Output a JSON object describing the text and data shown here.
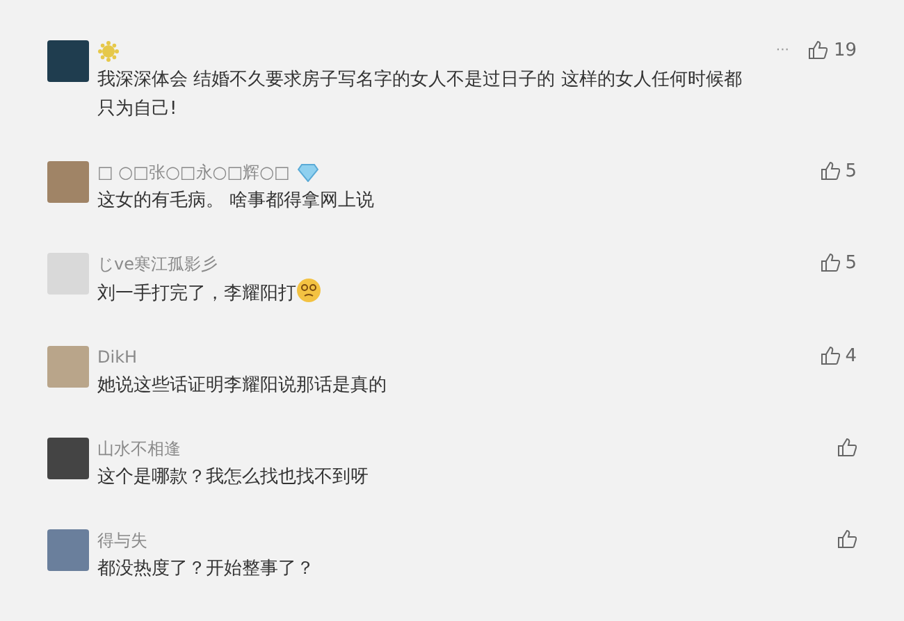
{
  "comments": [
    {
      "sun_badge": true,
      "text": "我深深体会 结婚不久要求房子写名字的女人不是过日子的  这样的女人任何时候都只为自己!",
      "more": "···",
      "likes": "19"
    },
    {
      "name": "□ ○□张○□永○□辉○□",
      "diamond_badge": true,
      "text": "这女的有毛病。 啥事都得拿网上说",
      "likes": "5"
    },
    {
      "name": "じve寒江孤影彡",
      "text": "刘一手打完了，李耀阳打",
      "emoji": true,
      "likes": "5"
    },
    {
      "name": "DikH",
      "text": "她说这些话证明李耀阳说那话是真的",
      "likes": "4"
    },
    {
      "name": "山水不相逢",
      "text": "这个是哪款？我怎么找也找不到呀"
    },
    {
      "name": "得与失",
      "text": "都没热度了？开始整事了？"
    }
  ]
}
